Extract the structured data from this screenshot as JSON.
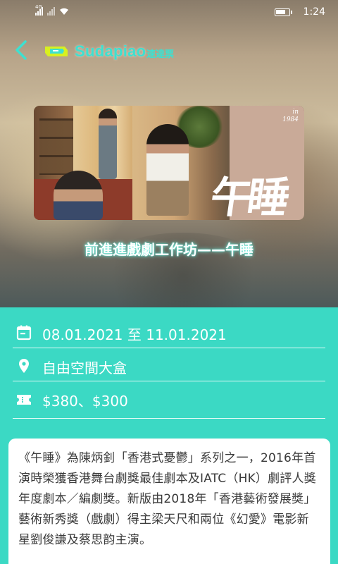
{
  "status_bar": {
    "network": "4G",
    "time": "1:24"
  },
  "header": {
    "brand": "Sudapiao",
    "brand_cn": "速達票"
  },
  "event": {
    "title": "前進進戲劇工作坊——午睡",
    "poster_text": {
      "corner_line1": "in",
      "corner_line2": "1984",
      "art_title": "午睡"
    },
    "date_range": "08.01.2021 至 11.01.2021",
    "venue": "自由空間大盒",
    "price": "$380、$300"
  },
  "description": "《午睡》為陳炳釗「香港式憂鬱」系列之一，2016年首演時榮獲香港舞台劇獎最佳劇本及IATC（HK）劇評人獎年度劇本／編劇獎。新版由2018年「香港藝術發展獎」藝術新秀獎（戲劇）得主梁天尺和兩位《幻愛》電影新星劉俊謙及蔡思韵主演。",
  "icons": {
    "back": "chevron-left-icon",
    "logo": "ticket-logo-icon",
    "date": "calendar-icon",
    "venue": "location-pin-icon",
    "price": "ticket-icon"
  },
  "colors": {
    "accent": "#3bd9c4",
    "brand_text": "#3ee0d0",
    "card": "#ffffff",
    "body_text": "#3a3a3a"
  }
}
